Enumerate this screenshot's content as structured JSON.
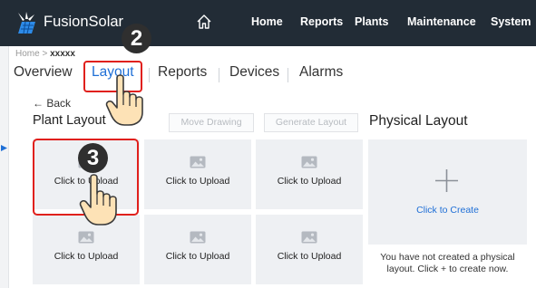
{
  "topbar": {
    "app_title": "FusionSolar",
    "nav": [
      "Home",
      "Reports",
      "Plants",
      "Maintenance",
      "System"
    ],
    "background": "#222c36"
  },
  "breadcrumb": {
    "home": "Home",
    "separator": ">",
    "current": "xxxxx"
  },
  "tabs": [
    "Overview",
    "Layout",
    "Reports",
    "Devices",
    "Alarms"
  ],
  "active_tab": "Layout",
  "accent": "#1f6fd6",
  "highlight_color": "#e0201c",
  "back_label": "← Back",
  "plant_layout": {
    "title": "Plant Layout",
    "move_drawing_label": "Move Drawing",
    "generate_layout_label": "Generate Layout",
    "tiles": [
      "Click to Upload",
      "Click to Upload",
      "Click to Upload",
      "Click to Upload",
      "Click to Upload",
      "Click to Upload"
    ]
  },
  "physical_layout": {
    "title": "Physical Layout",
    "create_label": "Click to Create",
    "note": "You have not created a physical layout. Click + to create now."
  },
  "steps": {
    "step2": "2",
    "step3": "3"
  },
  "icons": [
    "fusionsolar-logo-icon",
    "home-icon",
    "image-placeholder-icon",
    "plus-icon",
    "hand-pointer-icon"
  ]
}
